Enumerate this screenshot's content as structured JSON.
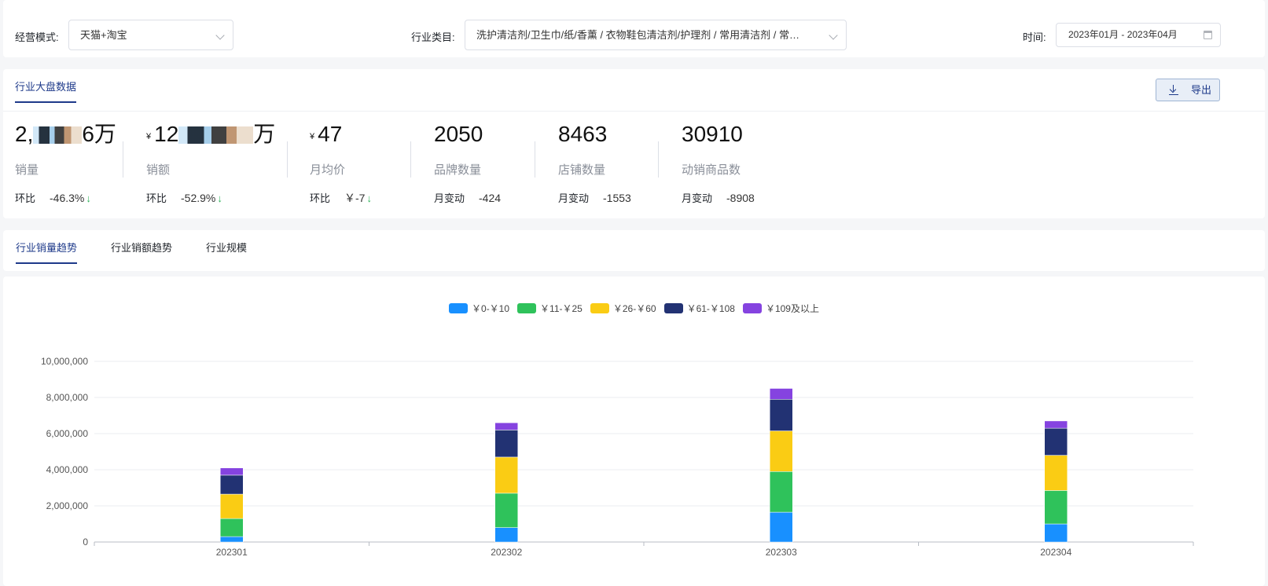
{
  "filters": {
    "mode_label": "经营模式:",
    "mode_value": "天猫+淘宝",
    "category_label": "行业类目:",
    "category_value": "洗护清洁剂/卫生巾/纸/香薰 / 衣物鞋包清洁剂/护理剂 / 常用清洁剂 / 常…",
    "time_label": "时间:",
    "time_value": "2023年01月 - 2023年04月"
  },
  "overview": {
    "tab": "行业大盘数据",
    "export_label": "导出",
    "currency": "¥",
    "arrow": "↓",
    "metrics": [
      {
        "prefix": "2,",
        "suffix": "6万",
        "name": "销量",
        "change_label": "环比",
        "change_value": "-46.3%"
      },
      {
        "prefix": "12",
        "suffix": "万",
        "name": "销额",
        "change_label": "环比",
        "change_value": "-52.9%"
      },
      {
        "value": "47",
        "name": "月均价",
        "change_label": "环比",
        "change_value": "￥-7"
      },
      {
        "value": "2050",
        "name": "品牌数量",
        "change_label": "月变动",
        "change_value": "-424"
      },
      {
        "value": "8463",
        "name": "店铺数量",
        "change_label": "月变动",
        "change_value": "-1553"
      },
      {
        "value": "30910",
        "name": "动销商品数",
        "change_label": "月变动",
        "change_value": "-8908"
      }
    ]
  },
  "trend_tabs": [
    "行业销量趋势",
    "行业销额趋势",
    "行业规模"
  ],
  "chart_data": {
    "type": "bar",
    "stacked": true,
    "categories": [
      "202301",
      "202302",
      "202303",
      "202304"
    ],
    "series": [
      {
        "name": "￥0-￥10",
        "color": "#1890ff",
        "values": [
          300000,
          800000,
          1650000,
          1000000
        ]
      },
      {
        "name": "￥11-￥25",
        "color": "#2fc25b",
        "values": [
          1000000,
          1900000,
          2250000,
          1850000
        ]
      },
      {
        "name": "￥26-￥60",
        "color": "#facc14",
        "values": [
          1350000,
          2000000,
          2250000,
          1950000
        ]
      },
      {
        "name": "￥61-￥108",
        "color": "#223273",
        "values": [
          1050000,
          1500000,
          1750000,
          1500000
        ]
      },
      {
        "name": "￥109及以上",
        "color": "#8543e0",
        "values": [
          400000,
          400000,
          600000,
          400000
        ]
      }
    ],
    "yticks": [
      "0",
      "2,000,000",
      "4,000,000",
      "6,000,000",
      "8,000,000",
      "10,000,000"
    ],
    "ylim": [
      0,
      10000000
    ],
    "grid": true,
    "legend": "top-center"
  }
}
